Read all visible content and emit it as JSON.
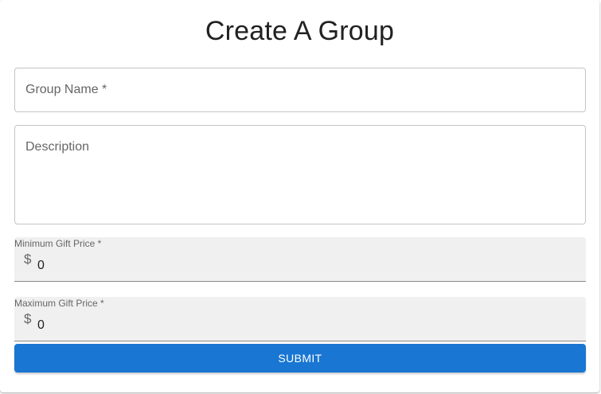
{
  "form": {
    "title": "Create A Group",
    "group_name_label": "Group Name *",
    "description_label": "Description",
    "min_price": {
      "label": "Minimum Gift Price *",
      "currency": "$",
      "value": "0"
    },
    "max_price": {
      "label": "Maximum Gift Price *",
      "currency": "$",
      "value": "0"
    },
    "submit_label": "SUBMIT"
  },
  "colors": {
    "accent": "#1976d2",
    "field_fill": "#f0f0f0",
    "border": "#c4c4c4"
  }
}
